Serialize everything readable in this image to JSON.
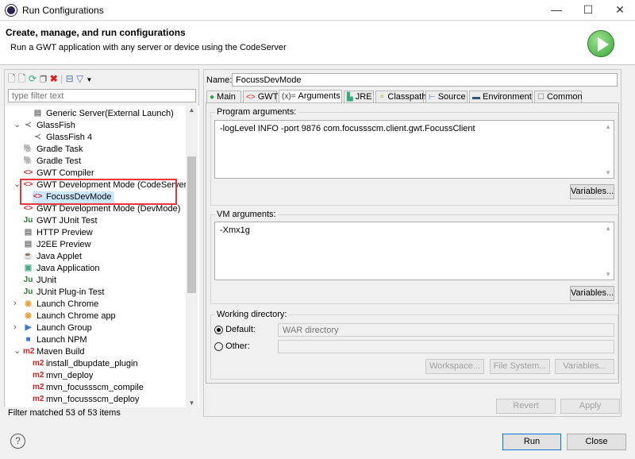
{
  "window": {
    "title": "Run Configurations",
    "minimize": "—",
    "maximize": "☐",
    "close": "✕"
  },
  "header": {
    "title": "Create, manage, and run configurations",
    "subtitle": "Run a GWT application with any server or device using the CodeServer"
  },
  "left": {
    "filter_placeholder": "type filter text",
    "status": "Filter matched 53 of 53 items",
    "items": [
      {
        "label": "Generic Server(External Launch)",
        "level": 1,
        "icon": "server-icon"
      },
      {
        "label": "GlassFish",
        "level": 0,
        "icon": "glassfish-icon",
        "expanded": true
      },
      {
        "label": "GlassFish 4",
        "level": 1,
        "icon": "glassfish-icon"
      },
      {
        "label": "Gradle Task",
        "level": 0,
        "icon": "gradle-icon"
      },
      {
        "label": "Gradle Test",
        "level": 0,
        "icon": "gradle-icon"
      },
      {
        "label": "GWT Compiler",
        "level": 0,
        "icon": "gwt-icon"
      },
      {
        "label": "GWT Development Mode (CodeServer)",
        "level": 0,
        "icon": "gwt-icon",
        "expanded": true
      },
      {
        "label": "FocussDevMode",
        "level": 1,
        "icon": "gwt-icon",
        "selected": true
      },
      {
        "label": "GWT Development Mode (DevMode)",
        "level": 0,
        "icon": "gwt-icon"
      },
      {
        "label": "GWT JUnit Test",
        "level": 0,
        "icon": "junit-icon"
      },
      {
        "label": "HTTP Preview",
        "level": 0,
        "icon": "server-icon"
      },
      {
        "label": "J2EE Preview",
        "level": 0,
        "icon": "server-icon"
      },
      {
        "label": "Java Applet",
        "level": 0,
        "icon": "applet-icon"
      },
      {
        "label": "Java Application",
        "level": 0,
        "icon": "java-app-icon"
      },
      {
        "label": "JUnit",
        "level": 0,
        "icon": "junit-icon"
      },
      {
        "label": "JUnit Plug-in Test",
        "level": 0,
        "icon": "junit-icon"
      },
      {
        "label": "Launch Chrome",
        "level": 0,
        "icon": "chrome-icon",
        "collapsed": true
      },
      {
        "label": "Launch Chrome app",
        "level": 0,
        "icon": "chrome-icon"
      },
      {
        "label": "Launch Group",
        "level": 0,
        "icon": "launch-group-icon",
        "collapsed": true
      },
      {
        "label": "Launch NPM",
        "level": 0,
        "icon": "npm-icon"
      },
      {
        "label": "Maven Build",
        "level": 0,
        "icon": "m2-icon",
        "expanded": true
      },
      {
        "label": "install_dbupdate_plugin",
        "level": 1,
        "icon": "m2-icon"
      },
      {
        "label": "mvn_deploy",
        "level": 1,
        "icon": "m2-icon"
      },
      {
        "label": "mvn_focussscm_compile",
        "level": 1,
        "icon": "m2-icon"
      },
      {
        "label": "mvn_focussscm_deploy",
        "level": 1,
        "icon": "m2-icon"
      }
    ]
  },
  "right": {
    "name_label": "Name:",
    "name_value": "FocussDevMode",
    "tabs": [
      {
        "label": "Main"
      },
      {
        "label": "GWT"
      },
      {
        "label": "Arguments",
        "active": true
      },
      {
        "label": "JRE"
      },
      {
        "label": "Classpath"
      },
      {
        "label": "Source"
      },
      {
        "label": "Environment"
      },
      {
        "label": "Common"
      }
    ],
    "program_args_label": "Program arguments:",
    "program_args": "-logLevel INFO -port 9876 com.focussscm.client.gwt.FocussClient",
    "vm_args_label": "VM arguments:",
    "vm_args": "-Xmx1g",
    "variables": "Variables...",
    "workdir_label": "Working directory:",
    "default_label": "Default:",
    "default_value": "WAR directory",
    "other_label": "Other:",
    "workspace": "Workspace...",
    "filesystem": "File System...",
    "revert": "Revert",
    "apply": "Apply"
  },
  "footer": {
    "help": "?",
    "run": "Run",
    "close": "Close"
  },
  "colors": {
    "selection": "#cce8ff",
    "highlight_box": "#e8383d",
    "gwt_red": "#d42a2a",
    "run_green": "#3aa63a"
  }
}
